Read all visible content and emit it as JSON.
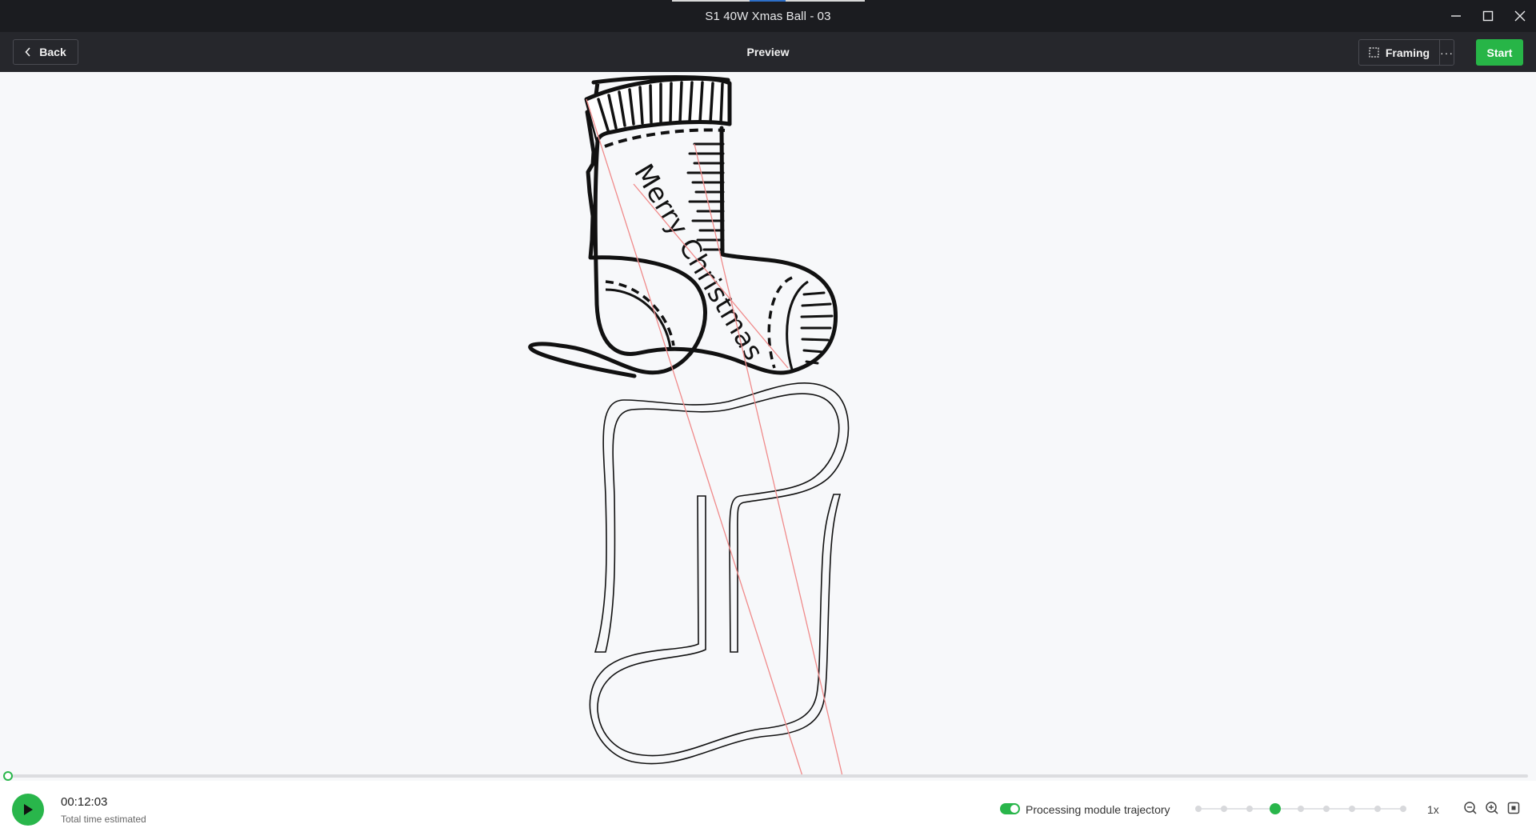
{
  "window": {
    "title": "S1 40W Xmas Ball - 03"
  },
  "toolbar": {
    "back_label": "Back",
    "page_title": "Preview",
    "framing_label": "Framing",
    "more_label": "···",
    "start_label": "Start"
  },
  "canvas": {
    "engraving_text": "Merry Christmas"
  },
  "playback": {
    "time": "00:12:03",
    "time_label": "Total time estimated",
    "progress": 0,
    "trajectory_toggle_label": "Processing module trajectory",
    "trajectory_enabled": true,
    "speed_steps": 9,
    "speed_selected_index": 3,
    "speed_label": "1x"
  },
  "colors": {
    "accent": "#29b64b",
    "titlebar": "#1b1c20",
    "toolbar": "#26272c",
    "canvas": "#f7f8fa",
    "trajectory": "#f08a8a"
  },
  "icons": {
    "back": "chevron-left-icon",
    "framing": "framing-icon",
    "play": "play-icon",
    "zoom_out": "zoom-out-icon",
    "zoom_in": "zoom-in-icon",
    "fit": "fit-screen-icon"
  }
}
